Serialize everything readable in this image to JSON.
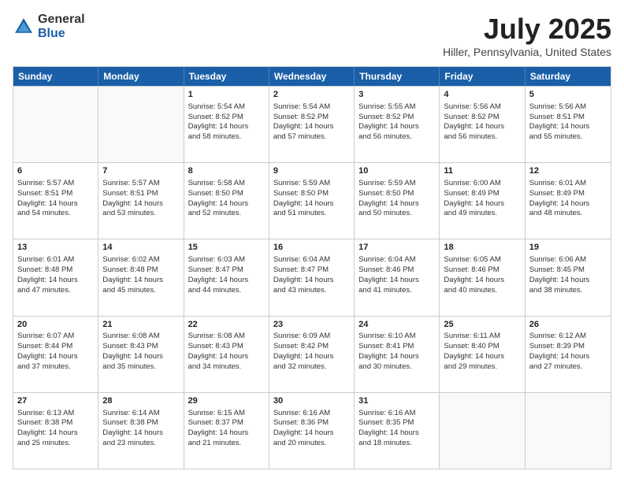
{
  "logo": {
    "general": "General",
    "blue": "Blue"
  },
  "title": "July 2025",
  "subtitle": "Hiller, Pennsylvania, United States",
  "days": [
    "Sunday",
    "Monday",
    "Tuesday",
    "Wednesday",
    "Thursday",
    "Friday",
    "Saturday"
  ],
  "rows": [
    [
      {
        "num": "",
        "lines": []
      },
      {
        "num": "",
        "lines": []
      },
      {
        "num": "1",
        "lines": [
          "Sunrise: 5:54 AM",
          "Sunset: 8:52 PM",
          "Daylight: 14 hours",
          "and 58 minutes."
        ]
      },
      {
        "num": "2",
        "lines": [
          "Sunrise: 5:54 AM",
          "Sunset: 8:52 PM",
          "Daylight: 14 hours",
          "and 57 minutes."
        ]
      },
      {
        "num": "3",
        "lines": [
          "Sunrise: 5:55 AM",
          "Sunset: 8:52 PM",
          "Daylight: 14 hours",
          "and 56 minutes."
        ]
      },
      {
        "num": "4",
        "lines": [
          "Sunrise: 5:56 AM",
          "Sunset: 8:52 PM",
          "Daylight: 14 hours",
          "and 56 minutes."
        ]
      },
      {
        "num": "5",
        "lines": [
          "Sunrise: 5:56 AM",
          "Sunset: 8:51 PM",
          "Daylight: 14 hours",
          "and 55 minutes."
        ]
      }
    ],
    [
      {
        "num": "6",
        "lines": [
          "Sunrise: 5:57 AM",
          "Sunset: 8:51 PM",
          "Daylight: 14 hours",
          "and 54 minutes."
        ]
      },
      {
        "num": "7",
        "lines": [
          "Sunrise: 5:57 AM",
          "Sunset: 8:51 PM",
          "Daylight: 14 hours",
          "and 53 minutes."
        ]
      },
      {
        "num": "8",
        "lines": [
          "Sunrise: 5:58 AM",
          "Sunset: 8:50 PM",
          "Daylight: 14 hours",
          "and 52 minutes."
        ]
      },
      {
        "num": "9",
        "lines": [
          "Sunrise: 5:59 AM",
          "Sunset: 8:50 PM",
          "Daylight: 14 hours",
          "and 51 minutes."
        ]
      },
      {
        "num": "10",
        "lines": [
          "Sunrise: 5:59 AM",
          "Sunset: 8:50 PM",
          "Daylight: 14 hours",
          "and 50 minutes."
        ]
      },
      {
        "num": "11",
        "lines": [
          "Sunrise: 6:00 AM",
          "Sunset: 8:49 PM",
          "Daylight: 14 hours",
          "and 49 minutes."
        ]
      },
      {
        "num": "12",
        "lines": [
          "Sunrise: 6:01 AM",
          "Sunset: 8:49 PM",
          "Daylight: 14 hours",
          "and 48 minutes."
        ]
      }
    ],
    [
      {
        "num": "13",
        "lines": [
          "Sunrise: 6:01 AM",
          "Sunset: 8:48 PM",
          "Daylight: 14 hours",
          "and 47 minutes."
        ]
      },
      {
        "num": "14",
        "lines": [
          "Sunrise: 6:02 AM",
          "Sunset: 8:48 PM",
          "Daylight: 14 hours",
          "and 45 minutes."
        ]
      },
      {
        "num": "15",
        "lines": [
          "Sunrise: 6:03 AM",
          "Sunset: 8:47 PM",
          "Daylight: 14 hours",
          "and 44 minutes."
        ]
      },
      {
        "num": "16",
        "lines": [
          "Sunrise: 6:04 AM",
          "Sunset: 8:47 PM",
          "Daylight: 14 hours",
          "and 43 minutes."
        ]
      },
      {
        "num": "17",
        "lines": [
          "Sunrise: 6:04 AM",
          "Sunset: 8:46 PM",
          "Daylight: 14 hours",
          "and 41 minutes."
        ]
      },
      {
        "num": "18",
        "lines": [
          "Sunrise: 6:05 AM",
          "Sunset: 8:46 PM",
          "Daylight: 14 hours",
          "and 40 minutes."
        ]
      },
      {
        "num": "19",
        "lines": [
          "Sunrise: 6:06 AM",
          "Sunset: 8:45 PM",
          "Daylight: 14 hours",
          "and 38 minutes."
        ]
      }
    ],
    [
      {
        "num": "20",
        "lines": [
          "Sunrise: 6:07 AM",
          "Sunset: 8:44 PM",
          "Daylight: 14 hours",
          "and 37 minutes."
        ]
      },
      {
        "num": "21",
        "lines": [
          "Sunrise: 6:08 AM",
          "Sunset: 8:43 PM",
          "Daylight: 14 hours",
          "and 35 minutes."
        ]
      },
      {
        "num": "22",
        "lines": [
          "Sunrise: 6:08 AM",
          "Sunset: 8:43 PM",
          "Daylight: 14 hours",
          "and 34 minutes."
        ]
      },
      {
        "num": "23",
        "lines": [
          "Sunrise: 6:09 AM",
          "Sunset: 8:42 PM",
          "Daylight: 14 hours",
          "and 32 minutes."
        ]
      },
      {
        "num": "24",
        "lines": [
          "Sunrise: 6:10 AM",
          "Sunset: 8:41 PM",
          "Daylight: 14 hours",
          "and 30 minutes."
        ]
      },
      {
        "num": "25",
        "lines": [
          "Sunrise: 6:11 AM",
          "Sunset: 8:40 PM",
          "Daylight: 14 hours",
          "and 29 minutes."
        ]
      },
      {
        "num": "26",
        "lines": [
          "Sunrise: 6:12 AM",
          "Sunset: 8:39 PM",
          "Daylight: 14 hours",
          "and 27 minutes."
        ]
      }
    ],
    [
      {
        "num": "27",
        "lines": [
          "Sunrise: 6:13 AM",
          "Sunset: 8:38 PM",
          "Daylight: 14 hours",
          "and 25 minutes."
        ]
      },
      {
        "num": "28",
        "lines": [
          "Sunrise: 6:14 AM",
          "Sunset: 8:38 PM",
          "Daylight: 14 hours",
          "and 23 minutes."
        ]
      },
      {
        "num": "29",
        "lines": [
          "Sunrise: 6:15 AM",
          "Sunset: 8:37 PM",
          "Daylight: 14 hours",
          "and 21 minutes."
        ]
      },
      {
        "num": "30",
        "lines": [
          "Sunrise: 6:16 AM",
          "Sunset: 8:36 PM",
          "Daylight: 14 hours",
          "and 20 minutes."
        ]
      },
      {
        "num": "31",
        "lines": [
          "Sunrise: 6:16 AM",
          "Sunset: 8:35 PM",
          "Daylight: 14 hours",
          "and 18 minutes."
        ]
      },
      {
        "num": "",
        "lines": []
      },
      {
        "num": "",
        "lines": []
      }
    ]
  ]
}
